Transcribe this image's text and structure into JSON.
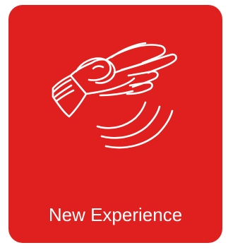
{
  "tile": {
    "label": "New Experience",
    "background_color": "#e0201f",
    "foreground_color": "#ffffff",
    "icon": "hand-with-vibration-waves-icon"
  }
}
